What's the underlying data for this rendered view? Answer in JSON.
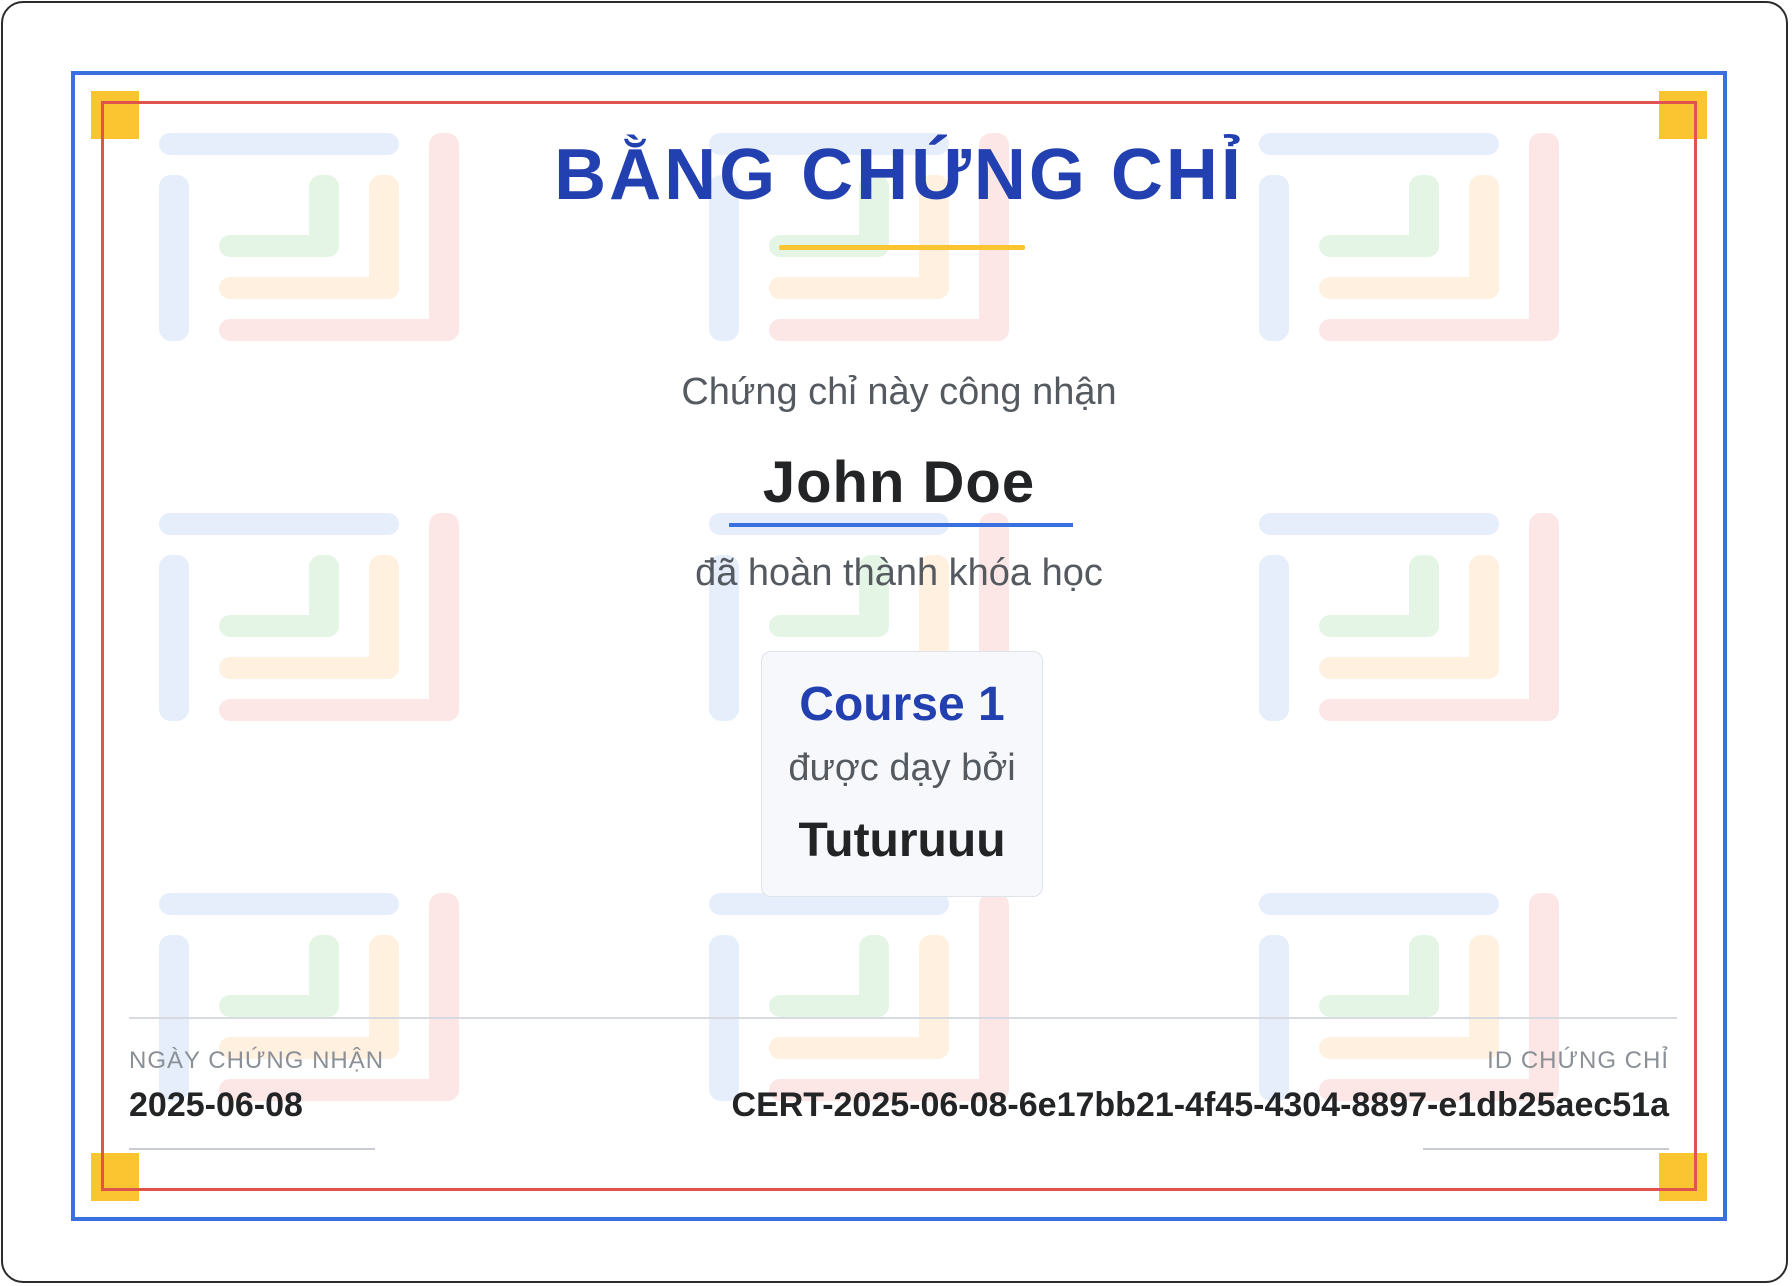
{
  "certificate": {
    "title": "BẰNG CHỨNG CHỈ",
    "recognition_text": "Chứng chỉ này công nhận",
    "recipient_name": "John Doe",
    "completion_text": "đã hoàn thành khóa học",
    "course": {
      "name": "Course 1",
      "taught_by_text": "được dạy bởi",
      "instructor": "Tuturuuu"
    },
    "footer": {
      "date_label": "NGÀY CHỨNG NHẬN",
      "date_value": "2025-06-08",
      "id_label": "ID CHỨNG CHỈ",
      "id_value": "CERT-2025-06-08-6e17bb21-4f45-4304-8897-e1db25aec51a"
    }
  },
  "colors": {
    "primary_blue": "#2340b0",
    "border_blue": "#3a6fe0",
    "border_red": "#e0534f",
    "accent_gold": "#fbc531"
  },
  "icons": {
    "watermark": "logo-watermark-icon",
    "corner": "corner-ornament"
  }
}
